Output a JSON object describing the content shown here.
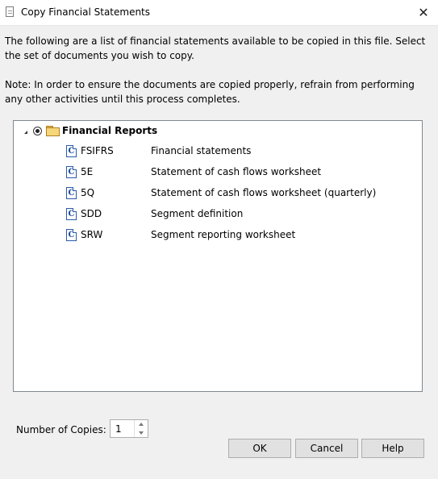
{
  "window": {
    "title": "Copy Financial Statements",
    "close_glyph": "✕"
  },
  "description": {
    "line1": "The following are a list of financial statements available to be copied in this file. Select the set of documents you wish to copy.",
    "line2": "Note: In order to ensure the documents are copied properly, refrain from performing any other activities until this process completes."
  },
  "tree": {
    "root": {
      "label": "Financial Reports",
      "selected": true,
      "expanded": true,
      "icon": "folder-icon"
    },
    "items": [
      {
        "code": "FSIFRS",
        "desc": "Financial statements",
        "icon": "c-document-icon",
        "icon_glyph": "C"
      },
      {
        "code": "5E",
        "desc": "Statement of cash flows worksheet",
        "icon": "c-document-icon",
        "icon_glyph": "C"
      },
      {
        "code": "5Q",
        "desc": "Statement of cash flows worksheet (quarterly)",
        "icon": "c-document-icon",
        "icon_glyph": "C"
      },
      {
        "code": "SDD",
        "desc": "Segment definition",
        "icon": "c-document-icon",
        "icon_glyph": "C"
      },
      {
        "code": "SRW",
        "desc": "Segment reporting worksheet",
        "icon": "c-document-icon",
        "icon_glyph": "C"
      }
    ]
  },
  "copies": {
    "label": "Number of Copies:",
    "value": "1"
  },
  "buttons": {
    "ok": "OK",
    "cancel": "Cancel",
    "help": "Help"
  },
  "colors": {
    "dialog_bg": "#f0f0f0",
    "doc_icon": "#2a5aa8",
    "folder": "#f6d67a"
  }
}
